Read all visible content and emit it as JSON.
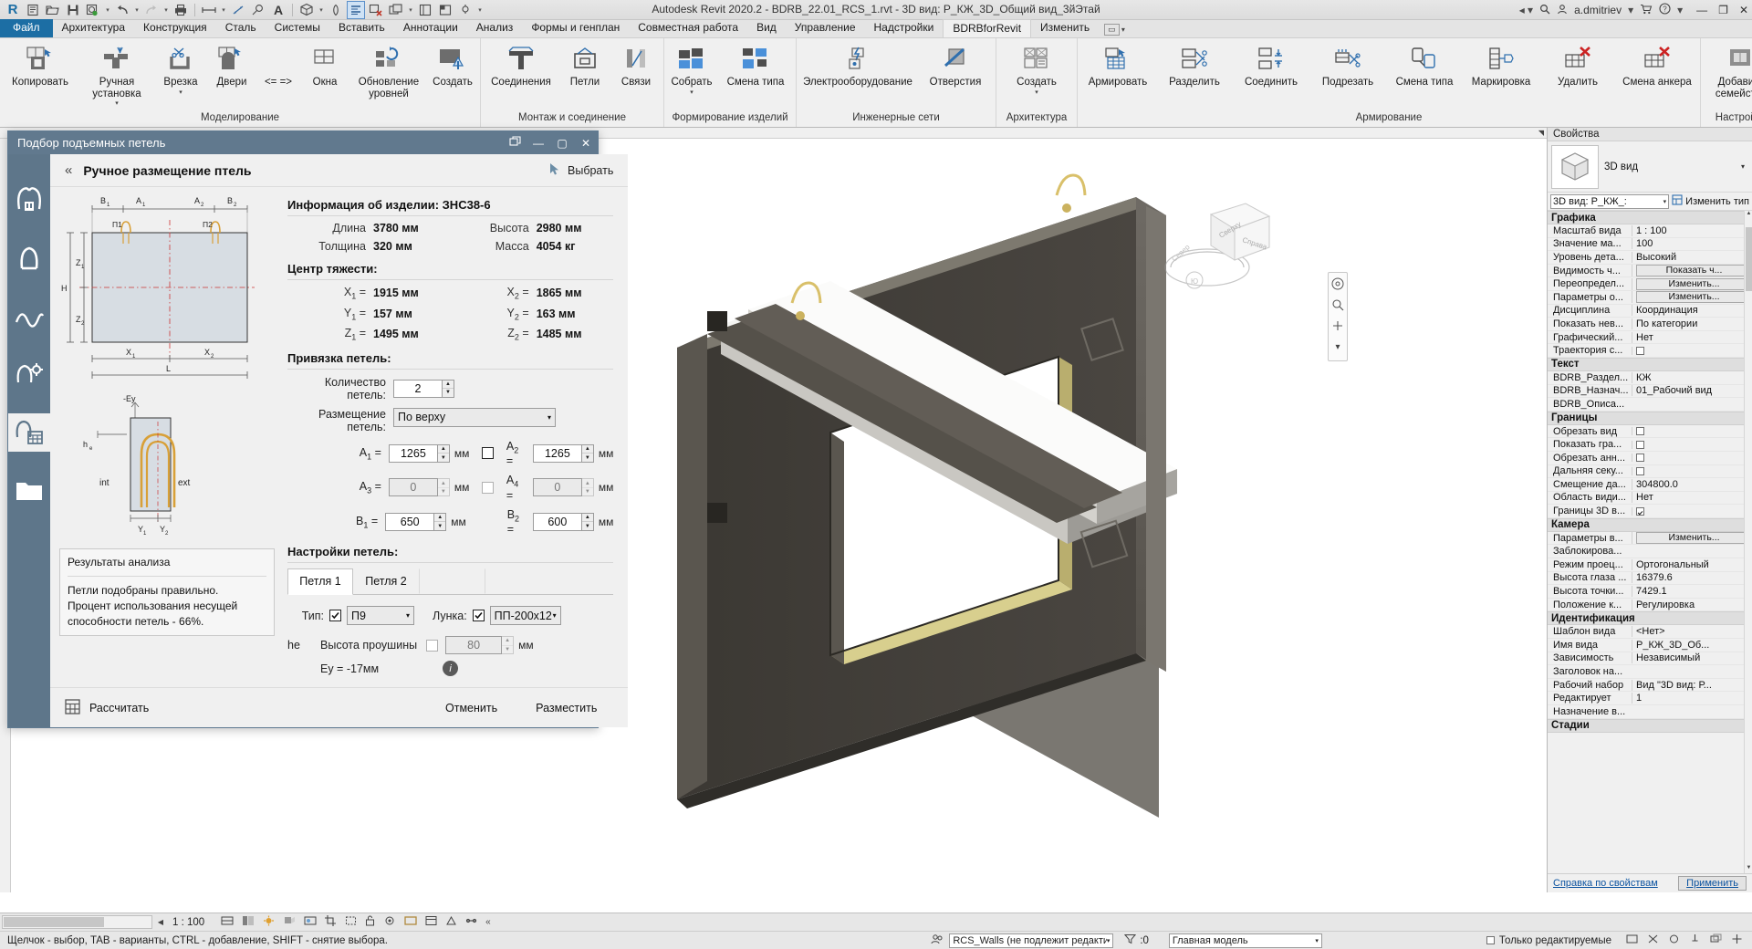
{
  "app": {
    "title": "Autodesk Revit 2020.2 - BDRB_22.01_RCS_1.rvt - 3D вид: Р_КЖ_3D_Общий вид_3йЭтай",
    "user": "a.dmitriev"
  },
  "quick_access": [
    {
      "name": "revit-logo-icon",
      "glyph": "R"
    },
    {
      "name": "new-project-icon",
      "glyph": "new"
    },
    {
      "name": "open-icon",
      "glyph": "open"
    },
    {
      "name": "save-icon",
      "glyph": "save"
    },
    {
      "name": "save-as-icon",
      "glyph": "saveas"
    },
    {
      "name": "undo-icon",
      "glyph": "undo"
    },
    {
      "name": "redo-icon",
      "glyph": "redo"
    },
    {
      "name": "print-icon",
      "glyph": "print"
    },
    {
      "name": "measure-icon",
      "glyph": "measure"
    },
    {
      "name": "aligned-dimension-icon",
      "glyph": "dim"
    },
    {
      "name": "tag-icon",
      "glyph": "tag"
    },
    {
      "name": "text-icon",
      "glyph": "A"
    },
    {
      "name": "default-3d-view-icon",
      "glyph": "box3d"
    },
    {
      "name": "section-icon",
      "glyph": "section"
    },
    {
      "name": "thin-lines-icon",
      "glyph": "thinlines"
    },
    {
      "name": "close-hidden-windows-icon",
      "glyph": "closehidden"
    },
    {
      "name": "switch-windows-icon",
      "glyph": "switchwin"
    },
    {
      "name": "user-interface-icon",
      "glyph": "ui"
    },
    {
      "name": "tile-windows-icon",
      "glyph": "tile"
    },
    {
      "name": "customize-qat-icon",
      "glyph": "customize"
    }
  ],
  "ribbon_tabs": [
    {
      "label": "Файл",
      "kind": "file"
    },
    {
      "label": "Архитектура",
      "kind": "normal"
    },
    {
      "label": "Конструкция",
      "kind": "normal"
    },
    {
      "label": "Сталь",
      "kind": "normal"
    },
    {
      "label": "Системы",
      "kind": "normal"
    },
    {
      "label": "Вставить",
      "kind": "normal"
    },
    {
      "label": "Аннотации",
      "kind": "normal"
    },
    {
      "label": "Анализ",
      "kind": "normal"
    },
    {
      "label": "Формы и генплан",
      "kind": "normal"
    },
    {
      "label": "Совместная работа",
      "kind": "normal"
    },
    {
      "label": "Вид",
      "kind": "normal"
    },
    {
      "label": "Управление",
      "kind": "normal"
    },
    {
      "label": "Надстройки",
      "kind": "normal"
    },
    {
      "label": "BDRBforRevit",
      "kind": "active"
    },
    {
      "label": "Изменить",
      "kind": "normal"
    }
  ],
  "ribbon_panels": [
    {
      "title": "Моделирование",
      "buttons": [
        {
          "label": "Копировать",
          "icon": "copy-element-icon",
          "dropdown": false,
          "width": "w80"
        },
        {
          "label": "Ручная\nустановка",
          "icon": "manual-placement-icon",
          "dropdown": true,
          "width": "w80"
        },
        {
          "label": "Врезка",
          "icon": "insert-cut-icon",
          "dropdown": true,
          "width": "w56"
        },
        {
          "label": "Двери",
          "icon": "door-icon",
          "dropdown": false,
          "width": "w56"
        },
        {
          "label": "Окна",
          "icon": "window-icon",
          "dropdown": false,
          "width": "w56",
          "prefix": "<= =>"
        },
        {
          "label": "Обновление\nуровней",
          "icon": "update-levels-icon",
          "dropdown": false,
          "width": "w80"
        },
        {
          "label": "Создать",
          "icon": "create-icon",
          "dropdown": false,
          "width": "w56"
        }
      ]
    },
    {
      "title": "Монтаж и соединение",
      "buttons": [
        {
          "label": "Соединения",
          "icon": "connections-icon",
          "dropdown": false,
          "width": "w80"
        },
        {
          "label": "Петли",
          "icon": "loops-icon",
          "dropdown": false,
          "width": "w56"
        },
        {
          "label": "Связи",
          "icon": "braces-icon",
          "dropdown": false,
          "width": "w56"
        }
      ]
    },
    {
      "title": "Формирование изделий",
      "buttons": [
        {
          "label": "Собрать",
          "icon": "assemble-icon",
          "dropdown": true,
          "width": "w56"
        },
        {
          "label": "Смена типа",
          "icon": "change-type-icon",
          "dropdown": false,
          "width": "w80"
        }
      ]
    },
    {
      "title": "Инженерные сети",
      "buttons": [
        {
          "label": "Электрооборудование",
          "icon": "electrical-equipment-icon",
          "dropdown": false,
          "width": "w140"
        },
        {
          "label": "Отверстия",
          "icon": "openings-icon",
          "dropdown": false,
          "width": "w80"
        }
      ]
    },
    {
      "title": "Архитектура",
      "buttons": [
        {
          "label": "Создать",
          "icon": "architecture-create-icon",
          "dropdown": true,
          "width": "w66"
        }
      ]
    },
    {
      "title": "Армирование",
      "buttons": [
        {
          "label": "Армировать",
          "icon": "reinforce-icon",
          "dropdown": false,
          "width": "w80"
        },
        {
          "label": "Разделить",
          "icon": "split-rebar-icon",
          "dropdown": false,
          "width": "w80"
        },
        {
          "label": "Соединить",
          "icon": "join-rebar-icon",
          "dropdown": false,
          "width": "w80"
        },
        {
          "label": "Подрезать",
          "icon": "trim-rebar-icon",
          "dropdown": false,
          "width": "w80"
        },
        {
          "label": "Смена типа",
          "icon": "rebar-change-type-icon",
          "dropdown": false,
          "width": "w80"
        },
        {
          "label": "Маркировка",
          "icon": "rebar-tag-icon",
          "dropdown": false,
          "width": "w80"
        },
        {
          "label": "Удалить",
          "icon": "delete-rebar-icon",
          "dropdown": false,
          "width": "w80"
        },
        {
          "label": "Смена анкера",
          "icon": "change-anchor-icon",
          "dropdown": false,
          "width": "w90"
        }
      ]
    },
    {
      "title": "Настройки",
      "buttons": [
        {
          "label": "Добавить\nсемейство",
          "icon": "add-family-icon",
          "dropdown": false,
          "width": "w80"
        }
      ]
    }
  ],
  "dialog": {
    "title": "Подбор подъемных петель",
    "window_buttons": [
      "restore-down",
      "minimize",
      "maximize",
      "close"
    ],
    "header": "Ручное размещение птель",
    "pick_button": "Выбрать",
    "rail_icons": [
      "loops-pair-icon",
      "loop-anchor-icon",
      "curve-loop-icon",
      "loop-calc-icon",
      "loop-table-icon",
      "folder-icon"
    ],
    "sketch_top": {
      "labels": [
        "B₁",
        "A₁",
        "A₂",
        "B₂",
        "П1",
        "П2",
        "Z₁",
        "Z₂",
        "H",
        "X₁",
        "X₂",
        "L"
      ]
    },
    "sketch_bottom": {
      "labels": [
        "-Ey",
        "int",
        "ext",
        "he",
        "Y₁",
        "Y₂"
      ]
    },
    "result": {
      "title": "Результаты анализа",
      "line1": "Петли подобраны правильно.",
      "line2": "Процент использования несущей способности петель - 66%."
    },
    "info": {
      "title": "Информация об изделии: ЗНС38-6",
      "rows": [
        {
          "k1": "Длина",
          "v1": "3780 мм",
          "k2": "Высота",
          "v2": "2980 мм"
        },
        {
          "k1": "Толщина",
          "v1": "320 мм",
          "k2": "Масса",
          "v2": "4054 кг"
        }
      ]
    },
    "gravity": {
      "title": "Центр тяжести:",
      "rows": [
        {
          "k1": "X",
          "s1": "1",
          "v1": "1915 мм",
          "k2": "X",
          "s2": "2",
          "v2": "1865 мм"
        },
        {
          "k1": "Y",
          "s1": "1",
          "v1": "157 мм",
          "k2": "Y",
          "s2": "2",
          "v2": "163 мм"
        },
        {
          "k1": "Z",
          "s1": "1",
          "v1": "1495 мм",
          "k2": "Z",
          "s2": "2",
          "v2": "1485 мм"
        }
      ]
    },
    "binding": {
      "title": "Привязка петель:",
      "count_label": "Количество петель:",
      "count_value": "2",
      "placement_label": "Размещение петель:",
      "placement_value": "По верху",
      "fields": [
        {
          "name": "A",
          "sub": "1",
          "value": "1265",
          "unit": "мм",
          "disabled": false,
          "cb": true,
          "cb_checked": false,
          "name2": "A",
          "sub2": "2",
          "value2": "1265",
          "unit2": "мм",
          "disabled2": false
        },
        {
          "name": "A",
          "sub": "3",
          "value": "0",
          "unit": "мм",
          "disabled": true,
          "cb": true,
          "cb_checked": false,
          "name2": "A",
          "sub2": "4",
          "value2": "0",
          "unit2": "мм",
          "disabled2": true
        },
        {
          "name": "B",
          "sub": "1",
          "value": "650",
          "unit": "мм",
          "disabled": false,
          "cb": false,
          "cb_checked": false,
          "name2": "B",
          "sub2": "2",
          "value2": "600",
          "unit2": "мм",
          "disabled2": false
        }
      ]
    },
    "settings": {
      "title": "Настройки петель:",
      "tabs": [
        {
          "label": "Петля 1",
          "active": true
        },
        {
          "label": "Петля 2",
          "active": false
        },
        {
          "label": "",
          "active": false
        },
        {
          "label": "",
          "active": false
        }
      ],
      "type_label": "Тип:",
      "type_checked": true,
      "type_value": "П9",
      "hole_label": "Лунка:",
      "hole_checked": true,
      "hole_value": "ПП-200х12",
      "he_symbol": "he",
      "he_label": "Высота проушины",
      "he_checked": false,
      "he_value": "80",
      "he_unit": "мм",
      "ey_text": "Ey = -17мм"
    },
    "footer": {
      "calc_label": "Рассчитать",
      "cancel_label": "Отменить",
      "place_label": "Разместить"
    }
  },
  "properties": {
    "panel_title": "Свойства",
    "type_name": "3D вид",
    "selector_value": "3D вид: Р_КЖ_:",
    "edit_type_label": "Изменить тип",
    "groups": [
      {
        "name": "Графика",
        "rows": [
          {
            "k": "Масштаб вида",
            "v": "1 : 100",
            "type": "text"
          },
          {
            "k": "Значение ма...",
            "v": "100",
            "type": "text"
          },
          {
            "k": "Уровень дета...",
            "v": "Высокий",
            "type": "text"
          },
          {
            "k": "Видимость ч...",
            "v": "Показать ч...",
            "type": "button"
          },
          {
            "k": "Переопредел...",
            "v": "Изменить...",
            "type": "button"
          },
          {
            "k": "Параметры о...",
            "v": "Изменить...",
            "type": "button"
          },
          {
            "k": "Дисциплина",
            "v": "Координация",
            "type": "text"
          },
          {
            "k": "Показать нев...",
            "v": "По категории",
            "type": "text"
          },
          {
            "k": "Графический...",
            "v": "Нет",
            "type": "text"
          },
          {
            "k": "Траектория с...",
            "v": "",
            "type": "checkbox",
            "checked": false
          }
        ]
      },
      {
        "name": "Текст",
        "rows": [
          {
            "k": "BDRB_Раздел...",
            "v": "КЖ",
            "type": "text"
          },
          {
            "k": "BDRB_Назнач...",
            "v": "01_Рабочий вид",
            "type": "text"
          },
          {
            "k": "BDRB_Описа...",
            "v": "",
            "type": "text"
          }
        ]
      },
      {
        "name": "Границы",
        "rows": [
          {
            "k": "Обрезать вид",
            "v": "",
            "type": "checkbox",
            "checked": false
          },
          {
            "k": "Показать гра...",
            "v": "",
            "type": "checkbox",
            "checked": false
          },
          {
            "k": "Обрезать анн...",
            "v": "",
            "type": "checkbox",
            "checked": false
          },
          {
            "k": "Дальняя секу...",
            "v": "",
            "type": "checkbox",
            "checked": false
          },
          {
            "k": "Смещение да...",
            "v": "304800.0",
            "type": "text"
          },
          {
            "k": "Область види...",
            "v": "Нет",
            "type": "text"
          },
          {
            "k": "Границы 3D в...",
            "v": "",
            "type": "checkbox",
            "checked": true
          }
        ]
      },
      {
        "name": "Камера",
        "rows": [
          {
            "k": "Параметры в...",
            "v": "Изменить...",
            "type": "button"
          },
          {
            "k": "Заблокирова...",
            "v": "",
            "type": "text"
          },
          {
            "k": "Режим проец...",
            "v": "Ортогональный",
            "type": "text"
          },
          {
            "k": "Высота глаза ...",
            "v": "16379.6",
            "type": "text"
          },
          {
            "k": "Высота точки...",
            "v": "7429.1",
            "type": "text"
          },
          {
            "k": "Положение к...",
            "v": "Регулировка",
            "type": "text"
          }
        ]
      },
      {
        "name": "Идентификация",
        "rows": [
          {
            "k": "Шаблон вида",
            "v": "<Нет>",
            "type": "text"
          },
          {
            "k": "Имя вида",
            "v": "Р_КЖ_3D_Об...",
            "type": "text"
          },
          {
            "k": "Зависимость",
            "v": "Независимый",
            "type": "text"
          },
          {
            "k": "Заголовок на...",
            "v": "",
            "type": "text"
          },
          {
            "k": "Рабочий набор",
            "v": "Вид \"3D вид: Р...",
            "type": "text"
          },
          {
            "k": "Редактирует",
            "v": "1",
            "type": "text"
          },
          {
            "k": "Назначение в...",
            "v": "",
            "type": "text"
          }
        ]
      },
      {
        "name": "Стадии",
        "rows": []
      }
    ],
    "help_link": "Справка по свойствам",
    "apply_label": "Применить"
  },
  "view_bar": {
    "scale": "1 : 100",
    "detail_level_icon": "detail-level-icon",
    "visual_style_icon": "visual-style-icon",
    "sun_icon": "sun-path-icon",
    "shadows_icon": "shadows-icon",
    "render_icon": "render-icon",
    "crop_icon": "crop-view-icon",
    "show_crop_icon": "show-crop-icon",
    "lock_icon": "unlocked-3d-view-icon",
    "temp_hide_icon": "temporary-hide-isolate-icon",
    "reveal_icon": "reveal-hidden-elements-icon",
    "analytical_icon": "analytical-model-icon",
    "constraints_icon": "constraints-icon",
    "more_icon": "more-icon"
  },
  "status_bar": {
    "hint": "Щелчок - выбор, TAB - варианты, CTRL - добавление, SHIFT - снятие выбора.",
    "workset_value": "RCS_Walls (не подлежит редактиров",
    "design_option_value": "Главная модель",
    "filter_count": ":0",
    "editable_only_label": "Только редактируемые",
    "editable_only_checked": false
  }
}
